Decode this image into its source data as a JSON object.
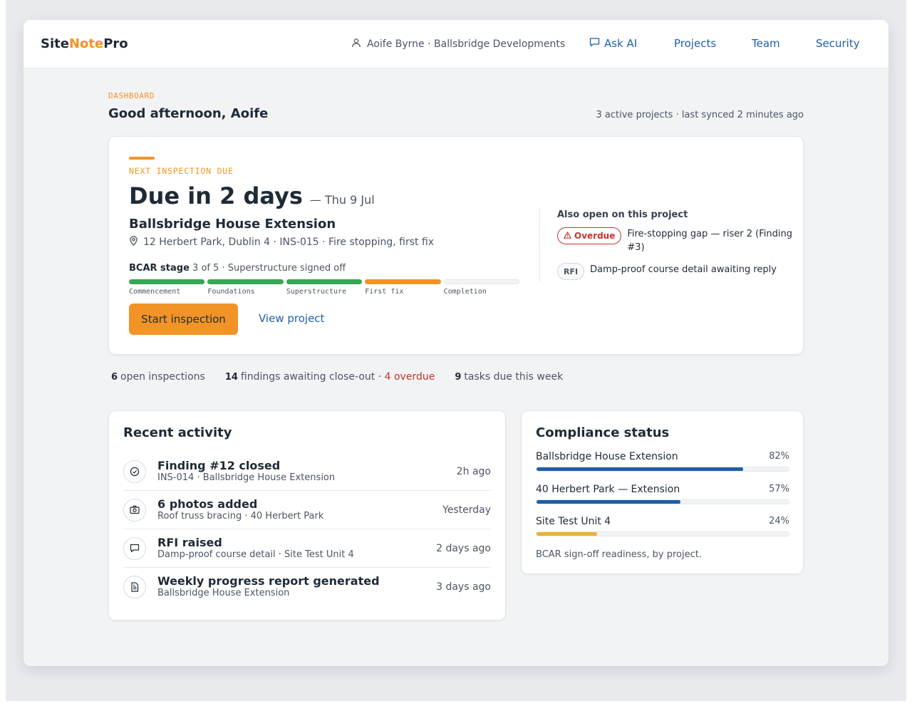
{
  "app": {
    "logo_part1": "Site",
    "logo_part2": "Note",
    "logo_part3": "Pro",
    "accent_color": "#f29425",
    "link_color": "#1f5fa6"
  },
  "header": {
    "user": "Aoife Byrne · Ballsbridge Developments",
    "user_icon": "person-icon",
    "nav": {
      "ask_ai": "Ask AI",
      "ask_ai_icon": "chat-bubble-icon",
      "projects": "Projects",
      "team": "Team",
      "security": "Security"
    }
  },
  "page": {
    "eyebrow": "DASHBOARD",
    "greeting": "Good afternoon, Aoife",
    "sync_status": "3 active projects · last synced 2 minutes ago"
  },
  "next_inspection": {
    "label": "NEXT INSPECTION DUE",
    "due": "Due in 2 days",
    "date": "— Thu 9 Jul",
    "project": "Ballsbridge House Extension",
    "address": "12 Herbert Park, Dublin 4 · INS-015 · Fire stopping, first fix",
    "address_icon": "location-pin-icon",
    "stage_label": "BCAR stage",
    "stage_detail": "3 of 5 · Superstructure signed off",
    "stages": [
      {
        "name": "Commencement",
        "status": "done"
      },
      {
        "name": "Foundations",
        "status": "done"
      },
      {
        "name": "Superstructure",
        "status": "done"
      },
      {
        "name": "First fix",
        "status": "current"
      },
      {
        "name": "Completion",
        "status": "pending"
      }
    ],
    "start_button": "Start inspection",
    "view_link": "View project",
    "also_open_title": "Also open on this project",
    "also_open": [
      {
        "badge": "Overdue",
        "badge_icon": "warning-icon",
        "text": "Fire-stopping gap — riser 2 (Finding #3)"
      },
      {
        "badge": "RFI",
        "text": "Damp-proof course detail awaiting reply"
      }
    ]
  },
  "stats": {
    "open_inspections_count": "6",
    "open_inspections_label": "open inspections",
    "findings_count": "14",
    "findings_label": "findings awaiting close-out ·",
    "findings_overdue": "4 overdue",
    "tasks_count": "9",
    "tasks_label": "tasks due this week"
  },
  "recent_activity": {
    "title": "Recent activity",
    "items": [
      {
        "icon": "check-circle-icon",
        "title": "Finding #12 closed",
        "sub": "INS-014 · Ballsbridge House Extension",
        "time": "2h ago"
      },
      {
        "icon": "camera-icon",
        "title": "6 photos added",
        "sub": "Roof truss bracing · 40 Herbert Park",
        "time": "Yesterday"
      },
      {
        "icon": "chat-bubble-icon",
        "title": "RFI raised",
        "sub": "Damp-proof course detail · Site Test Unit 4",
        "time": "2 days ago"
      },
      {
        "icon": "document-icon",
        "title": "Weekly progress report generated",
        "sub": "Ballsbridge House Extension",
        "time": "3 days ago"
      }
    ]
  },
  "compliance": {
    "title": "Compliance status",
    "items": [
      {
        "name": "Ballsbridge House Extension",
        "pct_label": "82%",
        "value": 0.82,
        "color": "#1f5fa6"
      },
      {
        "name": "40 Herbert Park — Extension",
        "pct_label": "57%",
        "value": 0.57,
        "color": "#1f5fa6"
      },
      {
        "name": "Site Test Unit 4",
        "pct_label": "24%",
        "value": 0.24,
        "color": "#e8b23a"
      }
    ],
    "note": "BCAR sign-off readiness, by project."
  }
}
